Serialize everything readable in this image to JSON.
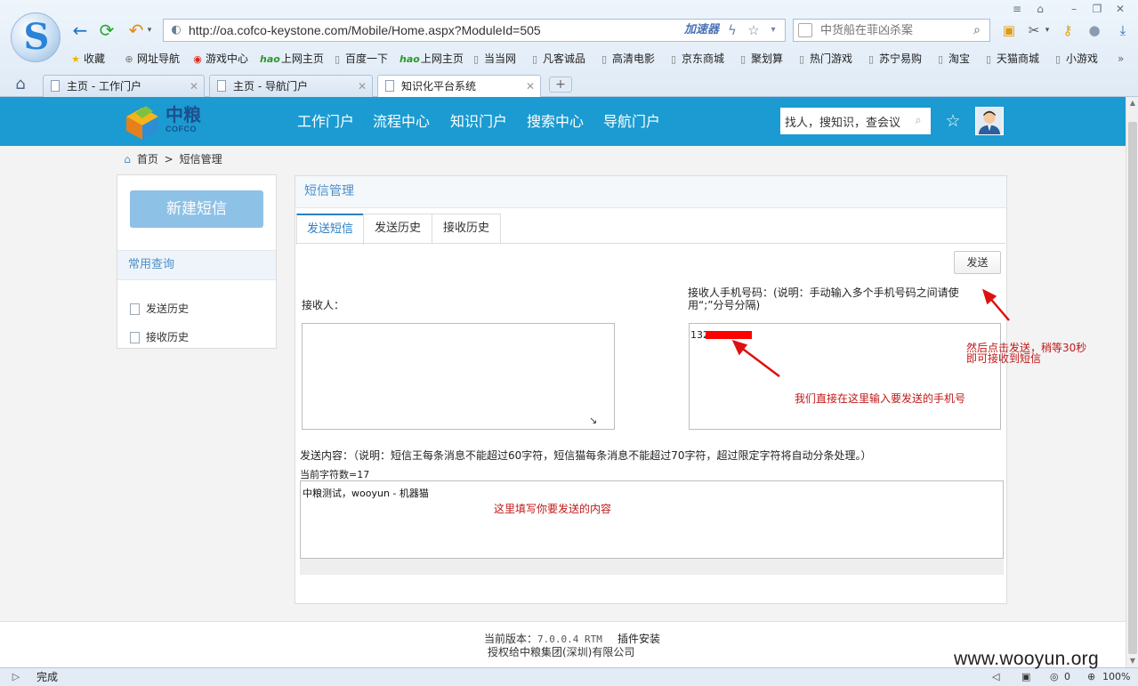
{
  "browser": {
    "url": "http://oa.cofco-keystone.com/Mobile/Home.aspx?ModuleId=505",
    "accelerator": "加速器",
    "search_placeholder": "中货船在菲凶杀案",
    "bookmarks": [
      {
        "label": "收藏"
      },
      {
        "label": "网址导航"
      },
      {
        "label": "游戏中心"
      },
      {
        "label": "上网主页",
        "hao": "hao"
      },
      {
        "label": "百度一下"
      },
      {
        "label": "上网主页",
        "hao": "hao"
      },
      {
        "label": "当当网"
      },
      {
        "label": "凡客诚品"
      },
      {
        "label": "高清电影"
      },
      {
        "label": "京东商城"
      },
      {
        "label": "聚划算"
      },
      {
        "label": "热门游戏"
      },
      {
        "label": "苏宁易购"
      },
      {
        "label": "淘宝"
      },
      {
        "label": "天猫商城"
      },
      {
        "label": "小游戏"
      }
    ],
    "tabs": [
      {
        "title": "主页 - 工作门户"
      },
      {
        "title": "主页 - 导航门户"
      },
      {
        "title": "知识化平台系统",
        "active": true
      }
    ],
    "status": "完成",
    "status_counter": "0",
    "zoom": "100%"
  },
  "site": {
    "logo_cn": "中粮",
    "logo_en": "COFCO",
    "nav": [
      "工作门户",
      "流程中心",
      "知识门户",
      "搜索中心",
      "导航门户"
    ],
    "search_value": "找人，搜知识，查会议",
    "breadcrumb": {
      "home": "首页",
      "sep": ">",
      "current": "短信管理"
    }
  },
  "sidebar": {
    "new_button": "新建短信",
    "section": "常用查询",
    "links": [
      "发送历史",
      "接收历史"
    ]
  },
  "panel": {
    "title": "短信管理",
    "tabs": [
      "发送短信",
      "发送历史",
      "接收历史"
    ],
    "send_button": "发送",
    "recipient_label": "接收人：",
    "phone_label_line1": "接收人手机号码：(说明：手动输入多个手机号码之间请使",
    "phone_label_line2": "用“;”分号分隔)",
    "phone_value": "132",
    "content_label": "发送内容：（说明：短信王每条消息不能超过60字符，短信猫每条消息不能超过70字符，超过限定字符将自动分条处理。）",
    "char_count": "当前字符数=17",
    "message": "中粮测试，wooyun - 机器猫"
  },
  "annotations": {
    "send_note_line1": "然后点击发送，稍等30秒",
    "send_note_line2": "即可接收到短信",
    "phone_note": "我们直接在这里输入要发送的手机号",
    "content_note": "这里填写你要发送的内容"
  },
  "footer": {
    "version_label": "当前版本：",
    "version": "7.0.0.4 RTM",
    "plugin": "插件安装",
    "authorized": "授权给中粮集团(深圳)有限公司"
  },
  "watermark": "www.wooyun.org",
  "colors": {
    "brand_bar": "#1b9bd1",
    "accent": "#2b7fc3",
    "annotation": "#c01818",
    "redaction": "#ff0000"
  }
}
